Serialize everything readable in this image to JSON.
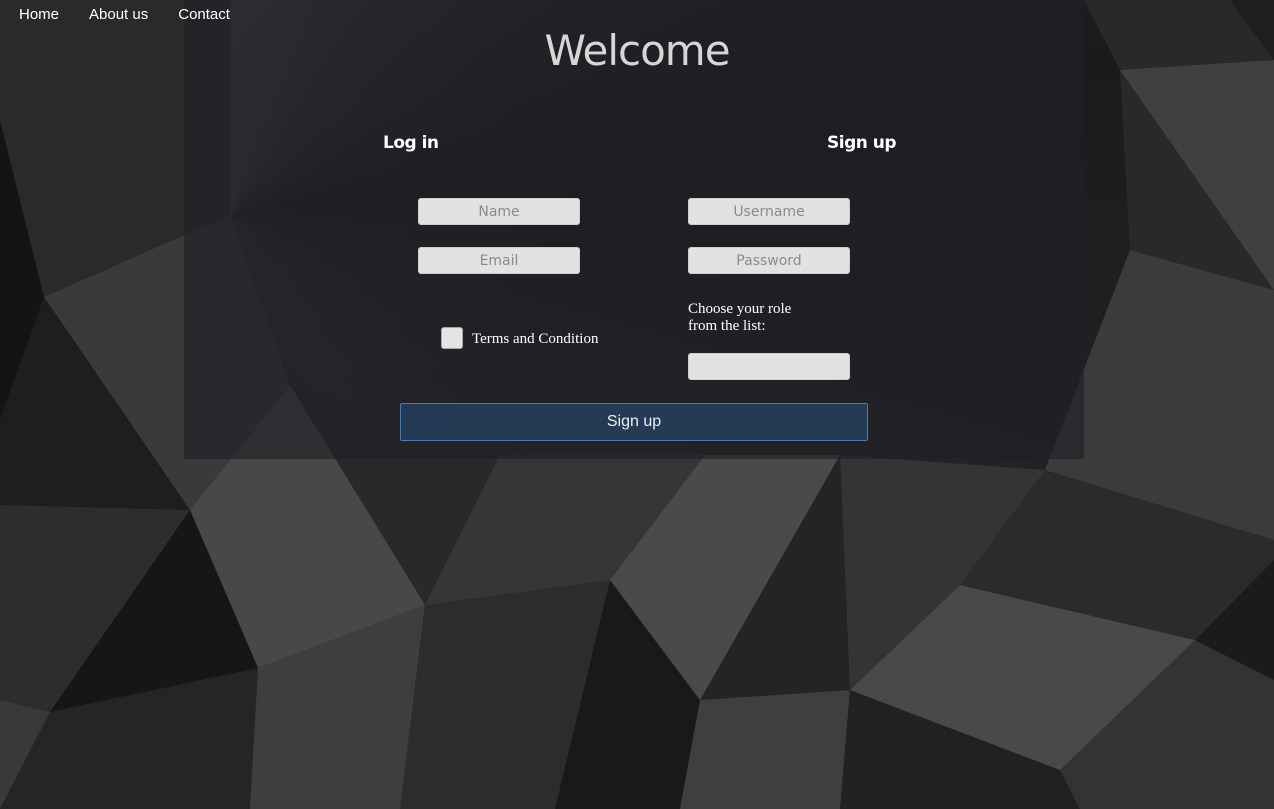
{
  "nav": {
    "items": [
      {
        "label": "Home"
      },
      {
        "label": "About us"
      },
      {
        "label": "Contact"
      }
    ]
  },
  "page": {
    "title": "Welcome"
  },
  "login": {
    "heading": "Log in",
    "name_placeholder": "Name",
    "email_placeholder": "Email",
    "terms_label": "Terms and Condition"
  },
  "signup": {
    "heading": "Sign up",
    "username_placeholder": "Username",
    "password_placeholder": "Password",
    "role_label": "Choose your role from the list:",
    "role_value": ""
  },
  "submit": {
    "label": "Sign up"
  },
  "colors": {
    "panel": "#1e2126",
    "button_fill": "#243e5e",
    "button_border": "#4a7bb0",
    "field_fill": "#e2e2e2"
  }
}
